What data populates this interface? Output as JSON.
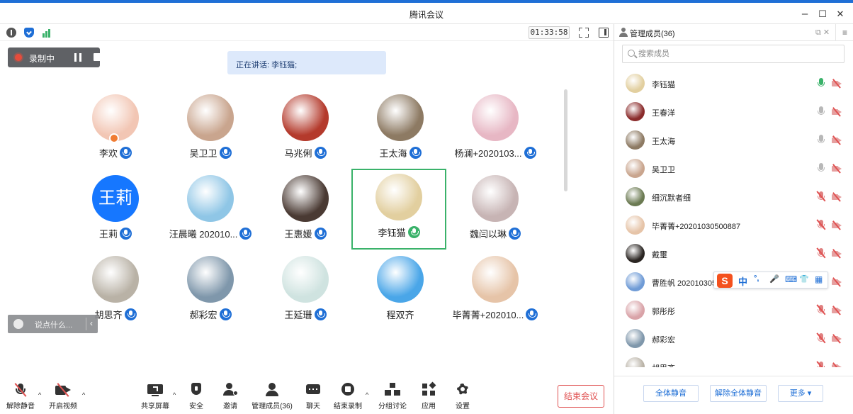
{
  "window": {
    "title": "腾讯会议",
    "minimize": "–",
    "maximize": "☐",
    "close": "✕"
  },
  "status": {
    "timer": "01:33:58"
  },
  "recording": {
    "label": "录制中"
  },
  "speaking": {
    "text": "正在讲话: 李钰猫;"
  },
  "grid": [
    {
      "name": "李欢",
      "mic": "blue",
      "host": true,
      "avatar_color": "#f2c6b4"
    },
    {
      "name": "吴卫卫",
      "mic": "blue",
      "avatar_color": "#c9a58e"
    },
    {
      "name": "马兆俐",
      "mic": "blue",
      "avatar_color": "#b43a2c"
    },
    {
      "name": "王太海",
      "mic": "blue",
      "avatar_color": "#8d7a63"
    },
    {
      "name": "杨澜+2020103...",
      "mic": "blue",
      "avatar_color": "#e7b7c4"
    },
    {
      "name": "王莉",
      "mic": "blue",
      "avatar_color": "#1677ff",
      "avatar_text": "王莉"
    },
    {
      "name": "汪晨曦 202010...",
      "mic": "blue",
      "avatar_color": "#8fc6e6"
    },
    {
      "name": "王惠媛",
      "mic": "blue",
      "avatar_color": "#4a3a33"
    },
    {
      "name": "李钰猫",
      "mic": "green",
      "active": true,
      "avatar_color": "#e2cf9f"
    },
    {
      "name": "魏闫以琳",
      "mic": "blue",
      "avatar_color": "#c7b4b4"
    },
    {
      "name": "胡思齐",
      "mic": "blue",
      "avatar_color": "#b9b2a6"
    },
    {
      "name": "郝彩宏",
      "mic": "blue",
      "avatar_color": "#7f97ab"
    },
    {
      "name": "王延珊",
      "mic": "blue",
      "avatar_color": "#cfe3e0"
    },
    {
      "name": "程双齐",
      "avatar_color": "#4aa6e8"
    },
    {
      "name": "毕菁菁+202010...",
      "mic": "blue",
      "avatar_color": "#e6c4a8"
    }
  ],
  "chat": {
    "placeholder": "说点什么...",
    "chevron": "‹"
  },
  "toolbar": {
    "caret": "^",
    "unmute": "解除静音",
    "video": "开启视频",
    "share": "共享屏幕",
    "security": "安全",
    "invite": "邀请",
    "members": "管理成员(36)",
    "chat": "聊天",
    "end_record": "结束录制",
    "breakout": "分组讨论",
    "apps": "应用",
    "settings": "设置",
    "end_meeting": "结束会议"
  },
  "sidebar": {
    "title": "管理成员(36)",
    "menu": "≡",
    "tools": "⧉ ✕",
    "search_placeholder": "搜索成员",
    "members": [
      {
        "name": "李钰猫",
        "mic": "on",
        "avatar_color": "#e2cf9f"
      },
      {
        "name": "王春洋",
        "mic": "idle",
        "avatar_color": "#8a2b2b"
      },
      {
        "name": "王太海",
        "mic": "idle",
        "avatar_color": "#8d7a63"
      },
      {
        "name": "吴卫卫",
        "mic": "idle",
        "avatar_color": "#c9a58e"
      },
      {
        "name": "细沉默者细",
        "mic": "muted",
        "avatar_color": "#6b7a52"
      },
      {
        "name": "毕菁菁+20201030500887",
        "mic": "muted",
        "avatar_color": "#e6c4a8"
      },
      {
        "name": "戴璽",
        "mic": "muted",
        "avatar_color": "#2a2522"
      },
      {
        "name": "曹胜帆 202010305",
        "mic": "muted",
        "avatar_color": "#6f9bd6"
      },
      {
        "name": "郭彤彤",
        "mic": "muted",
        "avatar_color": "#d9a3a8"
      },
      {
        "name": "郝彩宏",
        "mic": "muted",
        "avatar_color": "#7f97ab"
      },
      {
        "name": "胡思齐",
        "mic": "muted",
        "avatar_color": "#b9b2a6"
      }
    ],
    "ime": {
      "logo": "S",
      "glyphs": [
        "中",
        "°,",
        "🎤",
        "⌨",
        "👕",
        "▦"
      ]
    },
    "footer": {
      "mute_all": "全体静音",
      "unmute_all": "解除全体静音",
      "more": "更多 ▾"
    }
  },
  "colors": {
    "accent": "#1f6fd6",
    "speaking_bg": "#dde9fb",
    "active_border": "#3ab26a",
    "end": "#e05252"
  }
}
